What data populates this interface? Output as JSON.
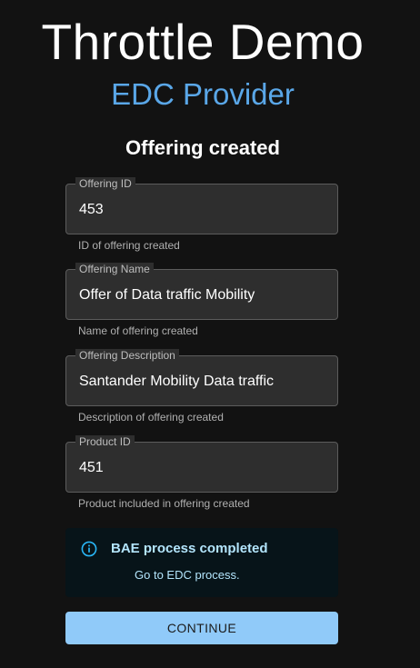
{
  "header": {
    "title": "Throttle Demo",
    "subtitle": "EDC Provider"
  },
  "section": {
    "title": "Offering created"
  },
  "fields": [
    {
      "label": "Offering ID",
      "value": "453",
      "helper": "ID of offering created"
    },
    {
      "label": "Offering Name",
      "value": "Offer of Data traffic Mobility",
      "helper": "Name of offering created"
    },
    {
      "label": "Offering Description",
      "value": "Santander Mobility Data traffic",
      "helper": "Description of offering created"
    },
    {
      "label": "Product ID",
      "value": "451",
      "helper": "Product included in offering created"
    }
  ],
  "alert": {
    "icon": "info-icon",
    "title": "BAE process completed",
    "message": "Go to EDC process."
  },
  "actions": {
    "continue_label": "CONTINUE"
  },
  "colors": {
    "background": "#121212",
    "accent": "#5aa7e8",
    "button": "#90caf9",
    "alert_background": "#071419",
    "alert_text": "#b3e5fc"
  }
}
